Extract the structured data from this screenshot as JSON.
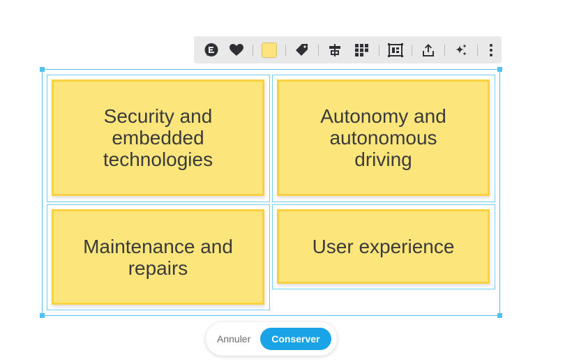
{
  "toolbar": {
    "items": [
      {
        "icon": "comment-icon"
      },
      {
        "icon": "heart-icon"
      },
      {
        "icon": "color-swatch",
        "color": "#fde47f"
      },
      {
        "icon": "tag-icon"
      },
      {
        "icon": "align-icon"
      },
      {
        "icon": "grid-icon"
      },
      {
        "icon": "frame-icon"
      },
      {
        "icon": "share-icon"
      },
      {
        "icon": "sparkle-icon"
      },
      {
        "icon": "more-icon"
      }
    ]
  },
  "notes": [
    {
      "text": "Security and embedded technologies"
    },
    {
      "text": "Autonomy and autonomous driving"
    },
    {
      "text": "Maintenance and repairs"
    },
    {
      "text": "User experience"
    }
  ],
  "actions": {
    "cancel_label": "Annuler",
    "keep_label": "Conserver"
  },
  "colors": {
    "note_fill": "#fce67c",
    "note_border": "#fad143",
    "selection": "#4ec3ec",
    "primary": "#1aa3e6"
  }
}
